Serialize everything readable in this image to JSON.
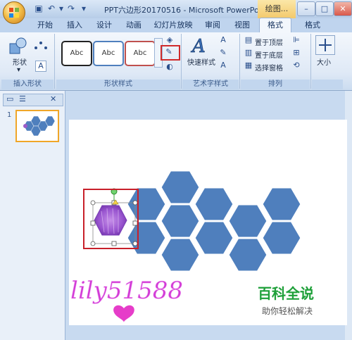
{
  "window": {
    "title": "PPT六边形20170516 - Microsoft PowerPo...",
    "context_tab": "绘图..."
  },
  "tabs": [
    "开始",
    "插入",
    "设计",
    "动画",
    "幻灯片放映",
    "审阅",
    "视图",
    "格式",
    "格式"
  ],
  "ribbon": {
    "insert_shapes": {
      "shape_label": "形状",
      "group_label": "插入形状"
    },
    "shape_styles": {
      "style_buttons": [
        "Abc",
        "Abc",
        "Abc"
      ],
      "group_label": "形状样式"
    },
    "wordart": {
      "quick_styles": "快速样式",
      "group_label": "艺术字样式"
    },
    "arrange": {
      "bring_front": "置于顶层",
      "send_back": "置于底层",
      "selection_pane": "选择窗格",
      "group_label": "排列"
    },
    "size": {
      "label": "大小"
    }
  },
  "slide_panel": {
    "slide_number": "1"
  },
  "watermark": {
    "handwriting": "lily51588",
    "site_name": "百科全说",
    "site_tagline": "助你轻松解决"
  },
  "colors": {
    "hex_fill": "#4f7fbd",
    "selection_box": "#c8202a",
    "handwriting": "#d23bd6"
  }
}
